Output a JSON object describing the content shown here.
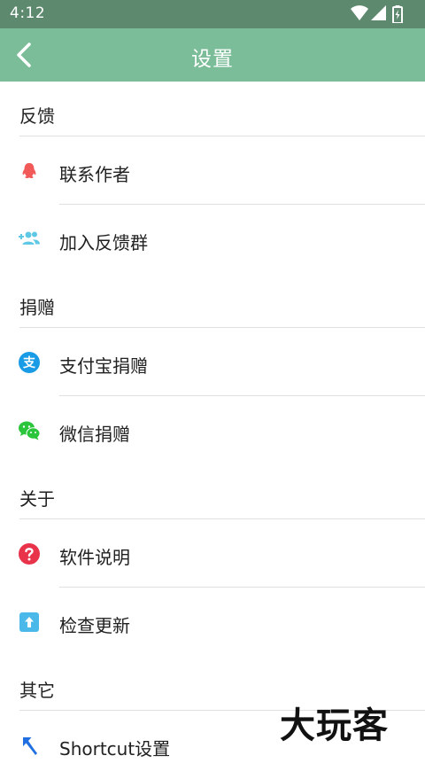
{
  "status_bar": {
    "time": "4:12"
  },
  "toolbar": {
    "title": "设置"
  },
  "sections": [
    {
      "header": "反馈",
      "items": [
        {
          "label": "联系作者",
          "icon": "qq-penguin-icon",
          "color": "#f25a5a"
        },
        {
          "label": "加入反馈群",
          "icon": "add-group-icon",
          "color": "#5ec8e5"
        }
      ]
    },
    {
      "header": "捐赠",
      "items": [
        {
          "label": "支付宝捐赠",
          "icon": "alipay-icon",
          "color": "#1a9be6"
        },
        {
          "label": "微信捐赠",
          "icon": "wechat-icon",
          "color": "#2bc53b"
        }
      ]
    },
    {
      "header": "关于",
      "items": [
        {
          "label": "软件说明",
          "icon": "help-icon",
          "color": "#e8334a"
        },
        {
          "label": "检查更新",
          "icon": "update-icon",
          "color": "#4ab8e8"
        }
      ]
    },
    {
      "header": "其它",
      "items": [
        {
          "label": "Shortcut设置",
          "icon": "shortcut-arrow-icon",
          "color": "#1f6fe0"
        }
      ]
    }
  ],
  "watermark": "大玩客",
  "colors": {
    "status_bar": "#5d8a6e",
    "toolbar": "#7bbd98",
    "divider": "#e0e0e0"
  }
}
